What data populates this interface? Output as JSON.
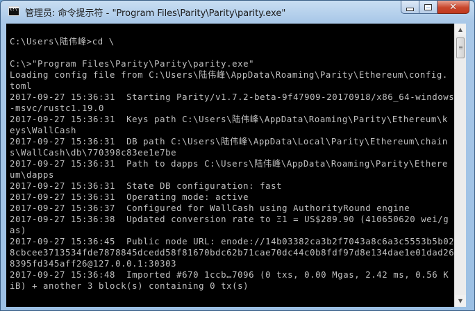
{
  "window": {
    "title": "管理员: 命令提示符 - \"Program Files\\Parity\\Parity\\parity.exe\"",
    "icon": "cmd-icon",
    "controls": {
      "minimize": "minimize-icon",
      "maximize": "maximize-icon",
      "close": "✕"
    }
  },
  "console": {
    "lines": [
      "C:\\Users\\陆伟峰>cd \\",
      "",
      "C:\\>\"Program Files\\Parity\\Parity\\parity.exe\"",
      "Loading config file from C:\\Users\\陆伟峰\\AppData\\Roaming\\Parity\\Ethereum\\config.",
      "toml",
      "2017-09-27 15:36:31  Starting Parity/v1.7.2-beta-9f47909-20170918/x86_64-windows",
      "-msvc/rustc1.19.0",
      "2017-09-27 15:36:31  Keys path C:\\Users\\陆伟峰\\AppData\\Roaming\\Parity\\Ethereum\\k",
      "eys\\WallCash",
      "2017-09-27 15:36:31  DB path C:\\Users\\陆伟峰\\AppData\\Local\\Parity\\Ethereum\\chain",
      "s\\WallCash\\db\\770398c83ee1e7be",
      "2017-09-27 15:36:31  Path to dapps C:\\Users\\陆伟峰\\AppData\\Roaming\\Parity\\Ethere",
      "um\\dapps",
      "2017-09-27 15:36:31  State DB configuration: fast",
      "2017-09-27 15:36:31  Operating mode: active",
      "2017-09-27 15:36:37  Configured for WallCash using AuthorityRound engine",
      "2017-09-27 15:36:38  Updated conversion rate to Ξ1 = US$289.90 (410650620 wei/g",
      "as)",
      "2017-09-27 15:36:45  Public node URL: enode://14b03382ca3b2f7043a8c6a3c5553b5b02",
      "8cbcee3713534fde7878845dcedd58f81670bdc62b71cae70dc44c0b8fdf97d8e134dae1e01dad26",
      "8395fd345aff26@127.0.0.1:30303",
      "2017-09-27 15:36:48  Imported #670 1ccb…7096 (0 txs, 0.00 Mgas, 2.42 ms, 0.56 K",
      "iB) + another 3 block(s) containing 0 tx(s)"
    ]
  },
  "scrollbar": {
    "up": "▲",
    "down": "▼"
  }
}
